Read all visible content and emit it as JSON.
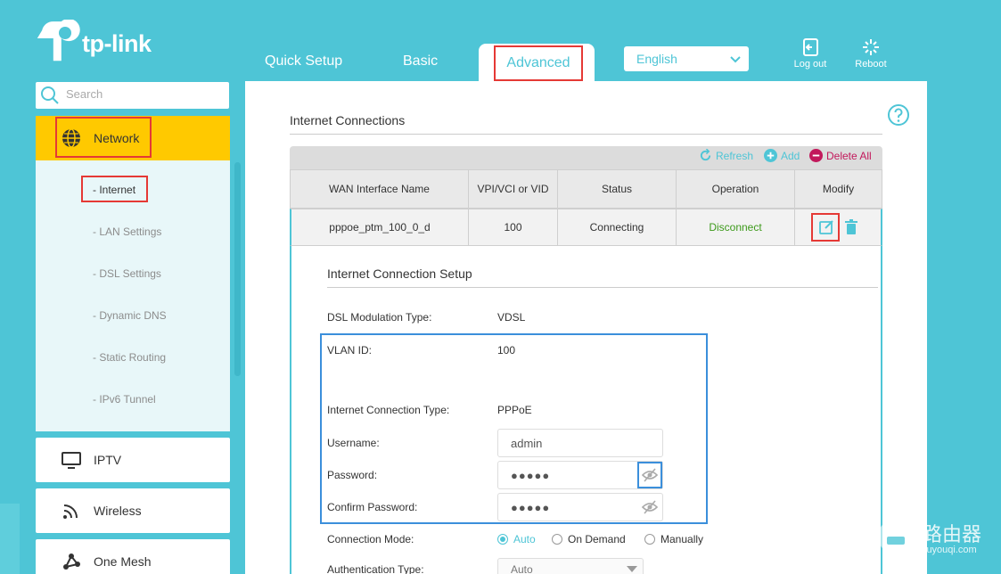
{
  "header": {
    "logo_text": "tp-link",
    "tabs": [
      {
        "label": "Quick Setup"
      },
      {
        "label": "Basic"
      },
      {
        "label": "Advanced"
      }
    ],
    "language": "English",
    "logout_label": "Log out",
    "reboot_label": "Reboot"
  },
  "sidebar": {
    "search_placeholder": "Search",
    "network_label": "Network",
    "network_items": [
      {
        "label": "- Internet"
      },
      {
        "label": "- LAN Settings"
      },
      {
        "label": "- DSL Settings"
      },
      {
        "label": "- Dynamic DNS"
      },
      {
        "label": "- Static Routing"
      },
      {
        "label": "- IPv6 Tunnel"
      }
    ],
    "sections": [
      {
        "label": "IPTV",
        "icon": "monitor-icon"
      },
      {
        "label": "Wireless",
        "icon": "wifi-icon"
      },
      {
        "label": "One Mesh",
        "icon": "mesh-icon"
      }
    ]
  },
  "main": {
    "section_title": "Internet Connections",
    "actions": {
      "refresh": "Refresh",
      "add": "Add",
      "delete_all": "Delete All"
    },
    "table": {
      "headers": [
        "WAN Interface Name",
        "VPI/VCI or VID",
        "Status",
        "Operation",
        "Modify"
      ],
      "row": {
        "name": "pppoe_ptm_100_0_d",
        "vid": "100",
        "status": "Connecting",
        "operation": "Disconnect"
      }
    },
    "setup": {
      "title": "Internet Connection Setup",
      "dsl_label": "DSL Modulation Type:",
      "dsl_value": "VDSL",
      "vlan_label": "VLAN ID:",
      "vlan_value": "100",
      "conn_type_label": "Internet Connection Type:",
      "conn_type_value": "PPPoE",
      "username_label": "Username:",
      "username_value": "admin",
      "password_label": "Password:",
      "password_value": "●●●●●",
      "confirm_label": "Confirm Password:",
      "confirm_value": "●●●●●",
      "mode_label": "Connection Mode:",
      "mode_options": [
        "Auto",
        "On Demand",
        "Manually"
      ],
      "mode_selected": "Auto",
      "auth_label": "Authentication Type:",
      "auth_value": "Auto"
    }
  },
  "watermark": {
    "text": "路由器",
    "sub": "luyouqi.com"
  },
  "colors": {
    "accent": "#4ec5d6",
    "network_highlight": "#ffc900",
    "red_box": "#e53935",
    "blue_box": "#3b8fdb",
    "disconnect": "#3d9a1b",
    "delete": "#c2185b"
  }
}
